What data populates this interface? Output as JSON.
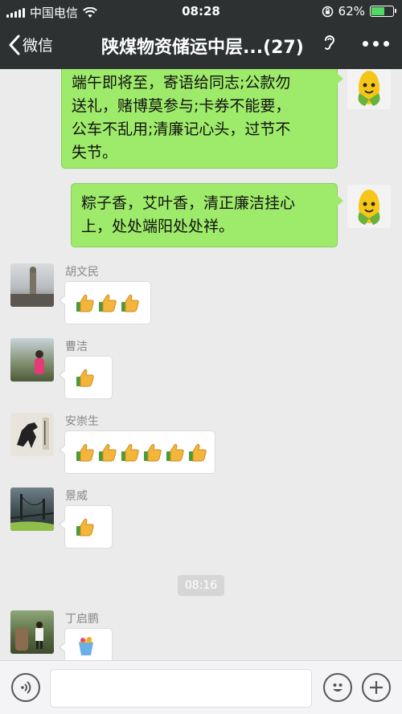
{
  "status_bar": {
    "carrier": "中国电信",
    "time": "08:28",
    "battery_percent": "62%",
    "battery_level": 0.62
  },
  "nav": {
    "back_label": "微信",
    "title": "陕煤物资储运中层...(27)"
  },
  "messages": [
    {
      "type": "outgoing",
      "text_lines": [
        "端午即将至，寄语给同志;公款勿",
        "送礼，赌博莫参与;卡券不能要，",
        "公车不乱用;清廉记心头，过节不",
        "失节。"
      ]
    },
    {
      "type": "outgoing",
      "text_lines": [
        "粽子香，艾叶香，清正廉洁挂心",
        "上，处处端阳处处祥。"
      ]
    },
    {
      "type": "incoming",
      "sender": "胡文民",
      "thumbs": 3
    },
    {
      "type": "incoming",
      "sender": "曹洁",
      "thumbs": 1
    },
    {
      "type": "incoming",
      "sender": "安崇生",
      "thumbs": 6
    },
    {
      "type": "incoming",
      "sender": "景威",
      "thumbs": 1
    },
    {
      "type": "timestamp",
      "text": "08:16"
    },
    {
      "type": "incoming",
      "sender": "丁启鹏",
      "sticker": "cup-sticker"
    }
  ],
  "colors": {
    "nav_bg": "#2e3132",
    "outgoing_bubble": "#9eea6a",
    "chat_bg": "#ebebeb"
  },
  "icons": {
    "back": "chevron-left-icon",
    "ear": "ear-icon",
    "more": "more-dots-icon",
    "voice": "voice-icon",
    "emoji": "emoji-icon",
    "plus": "plus-icon"
  }
}
